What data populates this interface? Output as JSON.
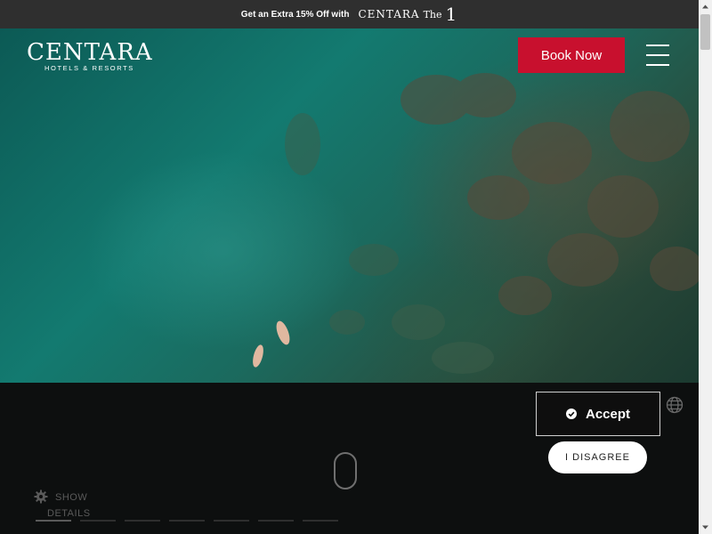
{
  "promo": {
    "text": "Get an Extra 15% Off with",
    "brand": "CENTARA",
    "brand_suffix": "The",
    "brand_mark": "1"
  },
  "header": {
    "logo_word": "CENTARA",
    "logo_sub": "HOTELS & RESORTS",
    "book_label": "Book Now",
    "menu_icon": "hamburger-menu-icon"
  },
  "hero": {
    "media": "aerial-sea-swimmers-image"
  },
  "footer": {
    "show_details_line1": "SHOW",
    "show_details_line2": "DETAILS",
    "progress_active_index": 0,
    "progress_segments": 7
  },
  "cookie": {
    "accept_label": "Accept",
    "disagree_label": "I DISAGREE",
    "language_icon": "globe-icon"
  },
  "colors": {
    "accent": "#c8102e",
    "promo_bg": "#2f2f2f",
    "panel_bg": "#0e0e0e"
  }
}
